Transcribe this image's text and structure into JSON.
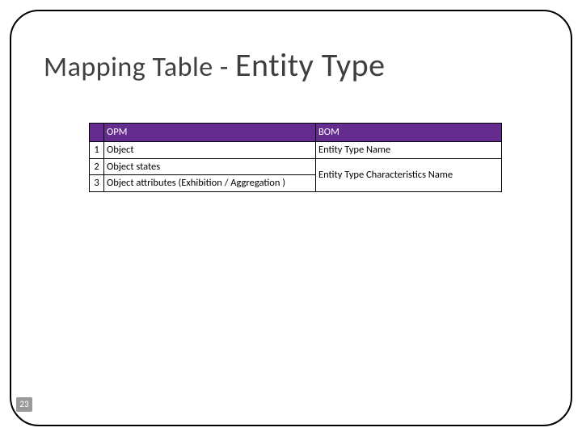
{
  "title": {
    "prefix": "Mapping Table - ",
    "emphasis": "Entity Type"
  },
  "table": {
    "headers": {
      "opm": "OPM",
      "bom": "BOM"
    },
    "rows": [
      {
        "n": "1",
        "opm": "Object",
        "bom": "Entity Type Name"
      },
      {
        "n": "2",
        "opm": "Object states"
      },
      {
        "n": "3",
        "opm": "Object attributes (Exhibition / Aggregation )"
      }
    ],
    "merged_bom_2_3": "Entity Type Characteristics Name"
  },
  "page_number": "23"
}
